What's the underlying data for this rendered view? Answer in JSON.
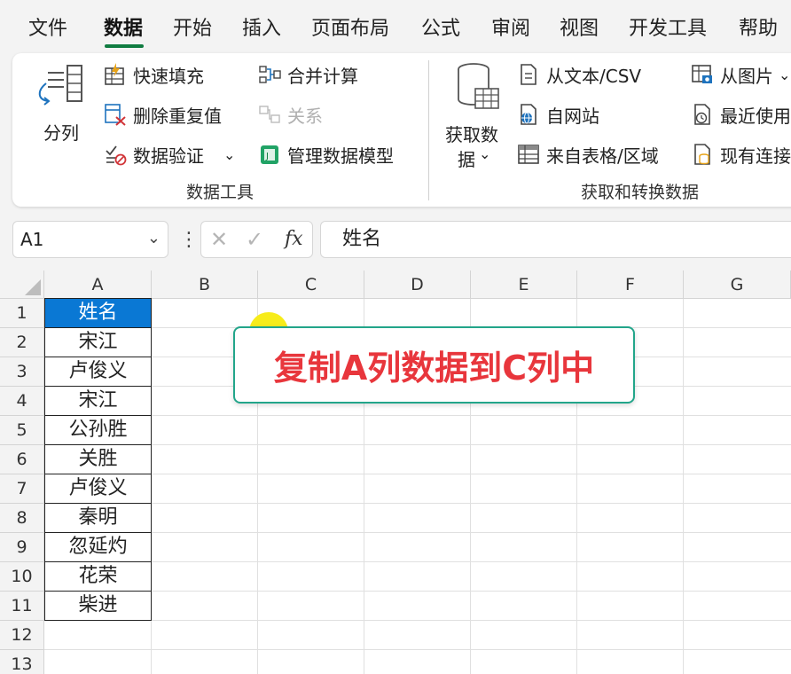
{
  "menu": {
    "tabs": [
      {
        "label": "文件"
      },
      {
        "label": "数据",
        "active": true
      },
      {
        "label": "开始"
      },
      {
        "label": "插入"
      },
      {
        "label": "页面布局"
      },
      {
        "label": "公式"
      },
      {
        "label": "审阅"
      },
      {
        "label": "视图"
      },
      {
        "label": "开发工具"
      },
      {
        "label": "帮助"
      }
    ]
  },
  "ribbon": {
    "data_tools": {
      "split_column": "分列",
      "flash_fill": "快速填充",
      "remove_duplicates": "删除重复值",
      "data_validation": "数据验证",
      "consolidate": "合并计算",
      "relationships": "关系",
      "manage_data_model": "管理数据模型",
      "group_label": "数据工具"
    },
    "get_transform": {
      "get_data_line1": "获取数",
      "get_data_line2": "据",
      "from_text_csv": "从文本/CSV",
      "from_web": "自网站",
      "from_table_range": "来自表格/区域",
      "from_picture": "从图片",
      "recent_sources": "最近使用",
      "existing_connections": "现有连接",
      "group_label": "获取和转换数据"
    },
    "accent_color": "#107c41"
  },
  "formula_bar": {
    "name_box": "A1",
    "fx_label": "fx",
    "formula": "姓名"
  },
  "sheet": {
    "columns": [
      "A",
      "B",
      "C",
      "D",
      "E",
      "F",
      "G"
    ],
    "rows": [
      "1",
      "2",
      "3",
      "4",
      "5",
      "6",
      "7",
      "8",
      "9",
      "10",
      "11",
      "12",
      "13"
    ],
    "column_a": [
      "姓名",
      "宋江",
      "卢俊义",
      "宋江",
      "公孙胜",
      "关胜",
      "卢俊义",
      "秦明",
      "忽延灼",
      "花荣",
      "柴进"
    ],
    "header_fill": "#0a78d4"
  },
  "callout": {
    "text": "复制A列数据到C列中",
    "text_color": "#e8363c",
    "border_color": "#22a58a"
  }
}
